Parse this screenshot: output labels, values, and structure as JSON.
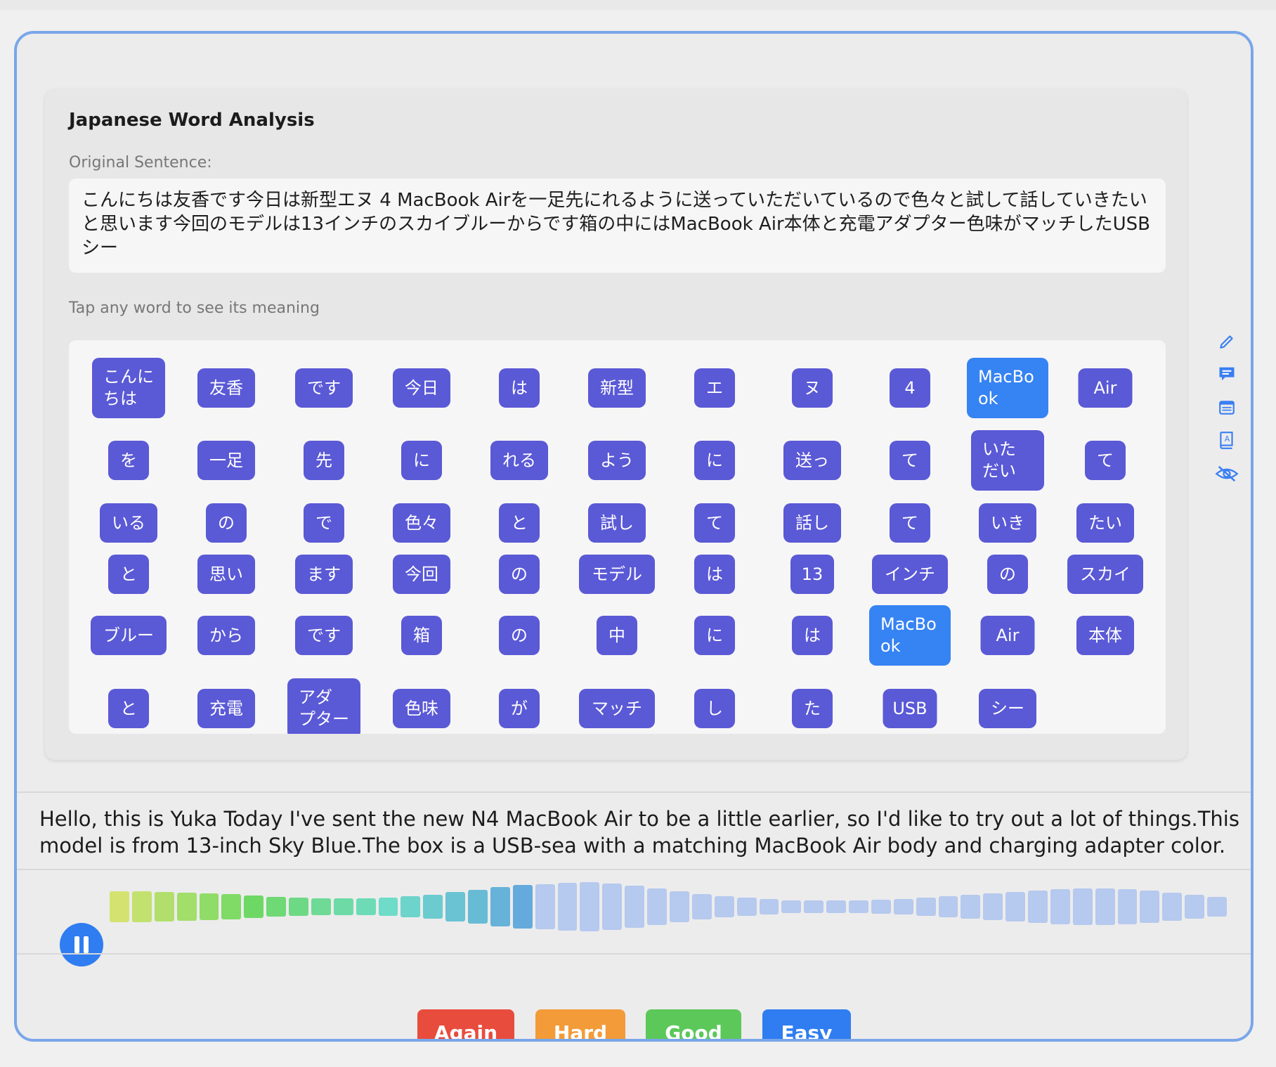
{
  "panel": {
    "title": "Japanese Word Analysis",
    "original_label": "Original Sentence:",
    "original_sentence": "こんにちは友香です今日は新型エヌ 4 MacBook Airを一足先にれるように送っていただいているので色々と試して話していきたいと思います今回のモデルは13インチのスカイブルーからです箱の中にはMacBook Air本体と充電アダプター色味がマッチしたUSBシー",
    "hint": "Tap any word to see its meaning"
  },
  "words": [
    "こんにちは",
    "友香",
    "です",
    "今日",
    "は",
    "新型",
    "エ",
    "ヌ",
    "4",
    "MacBook",
    "Air",
    "を",
    "一足",
    "先",
    "に",
    "れる",
    "よう",
    "に",
    "送っ",
    "て",
    "いただい",
    "て",
    "いる",
    "の",
    "で",
    "色々",
    "と",
    "試し",
    "て",
    "話し",
    "て",
    "いき",
    "たい",
    "と",
    "思い",
    "ます",
    "今回",
    "の",
    "モデル",
    "は",
    "13",
    "インチ",
    "の",
    "スカイ",
    "ブルー",
    "から",
    "です",
    "箱",
    "の",
    "中",
    "に",
    "は",
    "MacBook",
    "Air",
    "本体",
    "と",
    "充電",
    "アダプター",
    "色味",
    "が",
    "マッチ",
    "し",
    "た",
    "USB",
    "シー"
  ],
  "word_display": {
    "0": [
      "こんに",
      "ちは"
    ],
    "9": [
      "MacBo",
      "ok"
    ],
    "20": [
      "いた",
      "だい"
    ],
    "52": [
      "MacBo",
      "ok"
    ],
    "57": [
      "アダ",
      "プター"
    ]
  },
  "highlighted_words": [
    9,
    52
  ],
  "side_icons": [
    "pencil-icon",
    "comment-icon",
    "notes-icon",
    "dictionary-icon",
    "hide-eye-icon"
  ],
  "translation": "Hello, this is Yuka Today I've sent the new N4 MacBook Air to be a little earlier, so I'd like to try out a lot of things.This model is from 13-inch Sky Blue.The box is a USB-sea with a matching MacBook Air body and charging adapter color.",
  "player": {
    "state": "playing",
    "control_icon": "pause-icon",
    "progress": 0.38
  },
  "grade_buttons": {
    "again": "Again",
    "hard": "Hard",
    "good": "Good",
    "easy": "Easy"
  },
  "colors": {
    "accent": "#3683f3",
    "word_chip": "#5a59d6",
    "card_border": "#7aa6ea",
    "again": "#e84c3d",
    "hard": "#f29b38",
    "good": "#5cc85a",
    "easy": "#2f7df0"
  }
}
